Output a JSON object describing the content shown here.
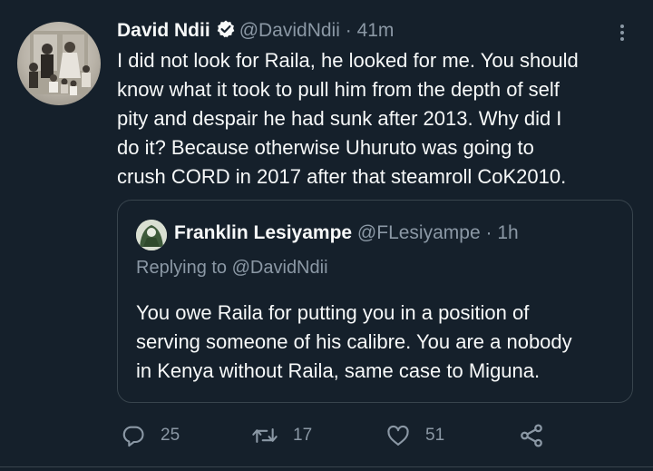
{
  "tweet": {
    "author_name": "David Ndii",
    "handle": "@DavidNdii",
    "separator": "·",
    "time": "41m",
    "text": "I did not look for Raila, he looked for me. You should\nknow what it took to pull him from the depth of self\npity and despair he had sunk after 2013. Why did I\ndo it? Because otherwise Uhuruto was going to\ncrush CORD in 2017 after that steamroll CoK2010."
  },
  "quoted_tweet": {
    "author_name": "Franklin Lesiyampe",
    "handle": "@FLesiyampe",
    "separator": "·",
    "time": "1h",
    "replying_to_label": "Replying to",
    "replying_to_handle": "@DavidNdii",
    "text": "You owe Raila for putting you in a position of\nserving someone of his calibre. You are a nobody\nin Kenya without Raila, same case to Miguna."
  },
  "actions": {
    "reply_count": "25",
    "retweet_count": "17",
    "like_count": "51"
  },
  "icons": {
    "verified": "verified-badge-icon",
    "more": "more-icon",
    "reply": "reply-icon",
    "retweet": "retweet-icon",
    "like": "heart-icon",
    "share": "share-icon"
  },
  "colors": {
    "background": "#15202b",
    "text_primary": "#f7f9f9",
    "text_secondary": "#8b98a5",
    "border": "#38444d"
  }
}
